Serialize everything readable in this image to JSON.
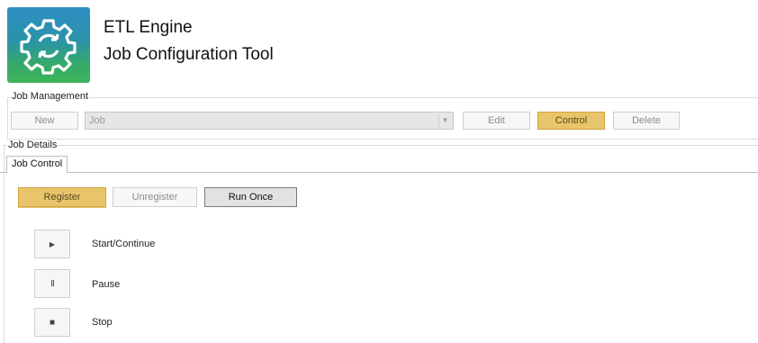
{
  "header": {
    "title": "ETL Engine",
    "subtitle": "Job Configuration Tool",
    "icon": "gear-refresh-icon"
  },
  "job_management": {
    "group_label": "Job Management",
    "new_label": "New",
    "job_select_value": "Job",
    "edit_label": "Edit",
    "control_label": "Control",
    "delete_label": "Delete",
    "selected": "Control"
  },
  "job_details": {
    "group_label": "Job Details",
    "tabs": [
      {
        "label": "Job Control"
      }
    ],
    "register_label": "Register",
    "unregister_label": "Unregister",
    "run_once_label": "Run Once",
    "controls": [
      {
        "icon": "play-icon",
        "glyph": "▶",
        "label": "Start/Continue"
      },
      {
        "icon": "pause-icon",
        "glyph": "II",
        "label": "Pause"
      },
      {
        "icon": "stop-icon",
        "glyph": "■",
        "label": "Stop"
      }
    ]
  },
  "colors": {
    "accent": "#e8c56a",
    "accent_border": "#d1a23c",
    "icon_top": "#2e8fc4",
    "icon_bottom": "#3db45a"
  }
}
